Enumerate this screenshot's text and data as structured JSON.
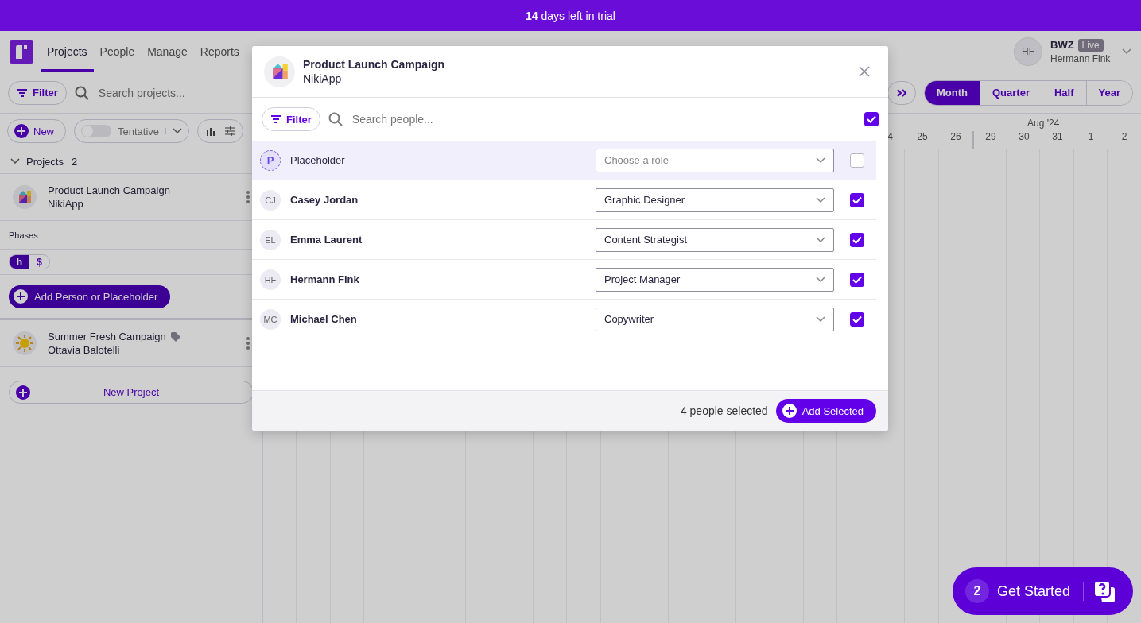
{
  "banner": {
    "text": "**14** days left in trial"
  },
  "nav": {
    "tabs": [
      {
        "label": "Projects",
        "selected": true
      },
      {
        "label": "People",
        "selected": false
      },
      {
        "label": "Manage",
        "selected": false
      },
      {
        "label": "Reports",
        "selected": false
      }
    ]
  },
  "account": {
    "initials": "HF",
    "org": "BWZ",
    "badge": "Live",
    "user": "Hermann Fink"
  },
  "toolbar": {
    "filter": "Filter",
    "search_placeholder": "Search projects...",
    "views": [
      {
        "label": "Month",
        "selected": true
      },
      {
        "label": "Quarter",
        "selected": false
      },
      {
        "label": "Half",
        "selected": false
      },
      {
        "label": "Year",
        "selected": false
      }
    ]
  },
  "actions": {
    "new": "New",
    "tentative": {
      "label": "Tentative",
      "on": false
    }
  },
  "timeline": {
    "month": "Aug '24",
    "days": [
      "4",
      "25",
      "26",
      "29",
      "30",
      "31",
      "1",
      "2"
    ]
  },
  "projects_group": {
    "label": "Projects",
    "count": "2",
    "expanded": true
  },
  "projects": [
    {
      "name": "Product Launch Campaign",
      "client": "NikiApp",
      "tagged": false
    },
    {
      "name": "Summer Fresh Campaign",
      "client": "Ottavia Balotelli",
      "tagged": true
    }
  ],
  "phases": {
    "label": "Phases",
    "units": [
      {
        "label": "h",
        "selected": true
      },
      {
        "label": "$",
        "selected": false
      }
    ]
  },
  "add_person": "Add Person or Placeholder",
  "new_project": "New Project",
  "modal": {
    "title": "Product Launch Campaign",
    "subtitle": "NikiApp",
    "filter": "Filter",
    "search_placeholder": "Search people...",
    "select_all": true,
    "rows": [
      {
        "kind": "placeholder",
        "initials": "P",
        "name": "Placeholder",
        "role_placeholder": "Choose a role",
        "checked": false
      },
      {
        "kind": "person",
        "initials": "CJ",
        "name": "Casey Jordan",
        "role": "Graphic Designer",
        "checked": true
      },
      {
        "kind": "person",
        "initials": "EL",
        "name": "Emma Laurent",
        "role": "Content Strategist",
        "checked": true
      },
      {
        "kind": "person",
        "initials": "HF",
        "name": "Hermann Fink",
        "role": "Project Manager",
        "checked": true
      },
      {
        "kind": "person",
        "initials": "MC",
        "name": "Michael Chen",
        "role": "Copywriter",
        "checked": true
      }
    ],
    "footer": {
      "count": "4 people selected",
      "button": "Add Selected"
    }
  },
  "get_started": {
    "count": "2",
    "label": "Get Started"
  }
}
